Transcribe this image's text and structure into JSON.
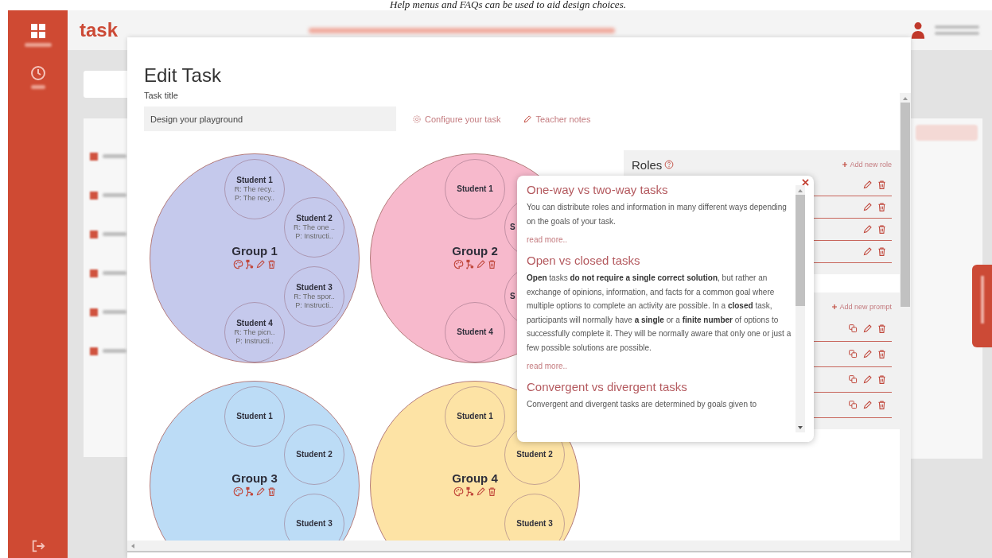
{
  "caption": "Help menus and FAQs can be used to aid design choices.",
  "app": {
    "logo": "task"
  },
  "modal": {
    "title": "Edit Task",
    "field_label": "Task title",
    "task_title": "Design your playground",
    "links": [
      {
        "kind": "configure",
        "label": "Configure your task"
      },
      {
        "kind": "notes",
        "label": "Teacher notes"
      }
    ],
    "groups": [
      {
        "name": "Group 1",
        "color": "#c5c9ec",
        "students": [
          {
            "kind": "full",
            "name": "Student 1",
            "lines": [
              "R: The recy..",
              "P: The recy.."
            ]
          },
          {
            "kind": "full",
            "name": "Student 2",
            "lines": [
              "R: The one ..",
              "P: Instructi.."
            ]
          },
          {
            "kind": "full",
            "name": "Student 3",
            "lines": [
              "R: The spor..",
              "P: Instructi.."
            ]
          },
          {
            "kind": "full",
            "name": "Student 4",
            "lines": [
              "R: The picn..",
              "P: Instructi.."
            ]
          }
        ]
      },
      {
        "name": "Group 2",
        "color": "#f7b9cc",
        "students": [
          {
            "kind": "full",
            "name": "Student 1"
          },
          {
            "kind": "partial",
            "name": "S"
          },
          {
            "kind": "partial",
            "name": "S"
          },
          {
            "kind": "full",
            "name": "Student 4"
          }
        ]
      },
      {
        "name": "Group 3",
        "color": "#bcdcf6",
        "students": [
          {
            "kind": "full",
            "name": "Student 1"
          },
          {
            "kind": "full",
            "name": "Student 2"
          },
          {
            "kind": "full",
            "name": "Student 3"
          }
        ]
      },
      {
        "name": "Group 4",
        "color": "#fde3a5",
        "students": [
          {
            "kind": "full",
            "name": "Student 1"
          },
          {
            "kind": "full",
            "name": "Student 2"
          },
          {
            "kind": "full",
            "name": "Student 3"
          }
        ]
      }
    ],
    "roles": {
      "title": "Roles",
      "add_label": "Add new role",
      "rows": [
        {
          "kind": "role"
        },
        {
          "kind": "role"
        },
        {
          "kind": "role"
        },
        {
          "kind": "role"
        }
      ]
    },
    "prompts": {
      "add_label": "Add new prompt",
      "rows": [
        {
          "kind": "prompt"
        },
        {
          "kind": "prompt"
        },
        {
          "kind": "prompt"
        },
        {
          "kind": "prompt"
        }
      ]
    },
    "help_popup": {
      "sections": [
        {
          "heading": "One-way vs two-way tasks",
          "body": "You can distribute roles and information in many different ways depending on the goals of your task.",
          "read_more": "read more.."
        },
        {
          "heading": "Open vs closed tasks",
          "body": "**Open** tasks **do not require a single correct solution**, but rather an exchange of opinions, information, and facts for a common goal where multiple options to complete an activity are possible. In a **closed** task, participants will normally have **a single** or a **finite number** of options to successfully complete it. They will be normally aware that only one or just a few possible solutions are possible.",
          "read_more": "read more.."
        },
        {
          "heading": "Convergent vs divergent tasks",
          "body": "Convergent and divergent tasks are determined by goals given to"
        }
      ]
    }
  }
}
